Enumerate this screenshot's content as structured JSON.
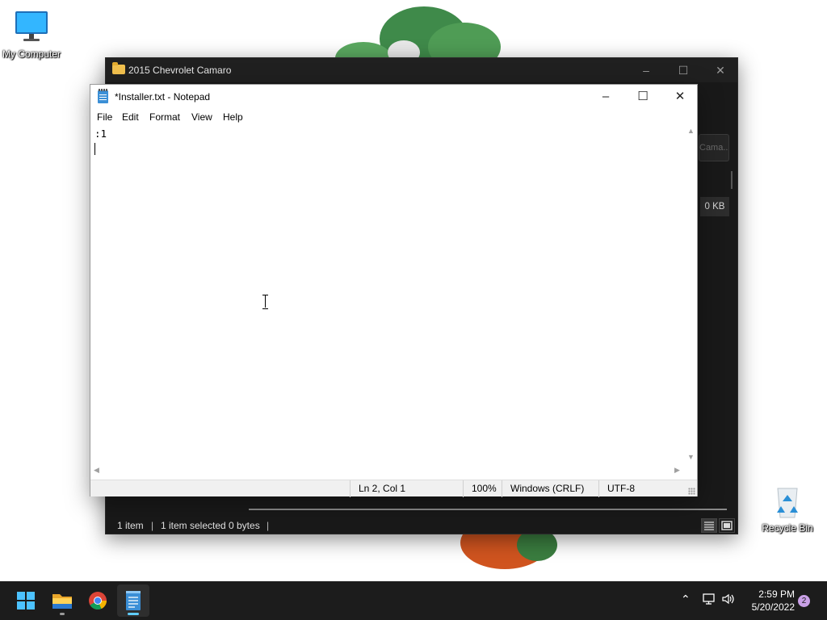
{
  "desktop": {
    "icons": [
      {
        "label": "My Computer"
      },
      {
        "label": "Recycle Bin"
      }
    ]
  },
  "explorer": {
    "title": "2015 Chevrolet Camaro",
    "side_button_label": "Cama...",
    "file_size": "0 KB",
    "status": {
      "item_count": "1 item",
      "separator": "|",
      "selected": "1 item selected",
      "selected_size": "0 bytes"
    }
  },
  "notepad": {
    "title": "*Installer.txt - Notepad",
    "menu": [
      "File",
      "Edit",
      "Format",
      "View",
      "Help"
    ],
    "content_line1": ":1",
    "status": {
      "position": "Ln 2, Col 1",
      "zoom": "100%",
      "line_ending": "Windows (CRLF)",
      "encoding": "UTF-8"
    }
  },
  "taskbar": {
    "pinned": [
      "start-icon",
      "file-explorer-icon",
      "chrome-icon",
      "notepad-icon"
    ],
    "time": "2:59 PM",
    "date": "5/20/2022",
    "notification_count": "2"
  },
  "colors": {
    "taskbar_bg": "#1c1c1c",
    "explorer_bg": "#191919",
    "accent": "#60cdff"
  }
}
